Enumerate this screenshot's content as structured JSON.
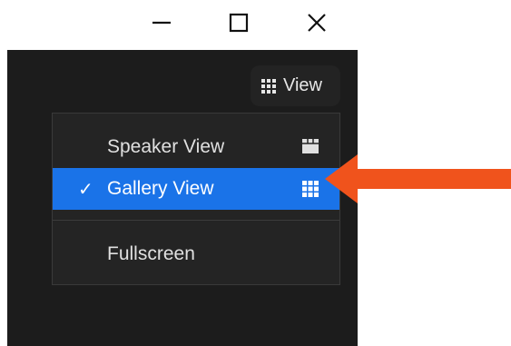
{
  "view_button": {
    "label": "View",
    "icon": "grid-icon"
  },
  "menu": {
    "items": [
      {
        "label": "Speaker View",
        "checked": false,
        "icon": "speaker-view-icon"
      },
      {
        "label": "Gallery View",
        "checked": true,
        "icon": "gallery-view-icon"
      },
      {
        "label": "Fullscreen",
        "checked": false
      }
    ],
    "check_glyph": "✓"
  },
  "colors": {
    "window_bg": "#1c1c1c",
    "menu_bg": "#242424",
    "selected_bg": "#1a73e8",
    "arrow": "#f0531c"
  }
}
